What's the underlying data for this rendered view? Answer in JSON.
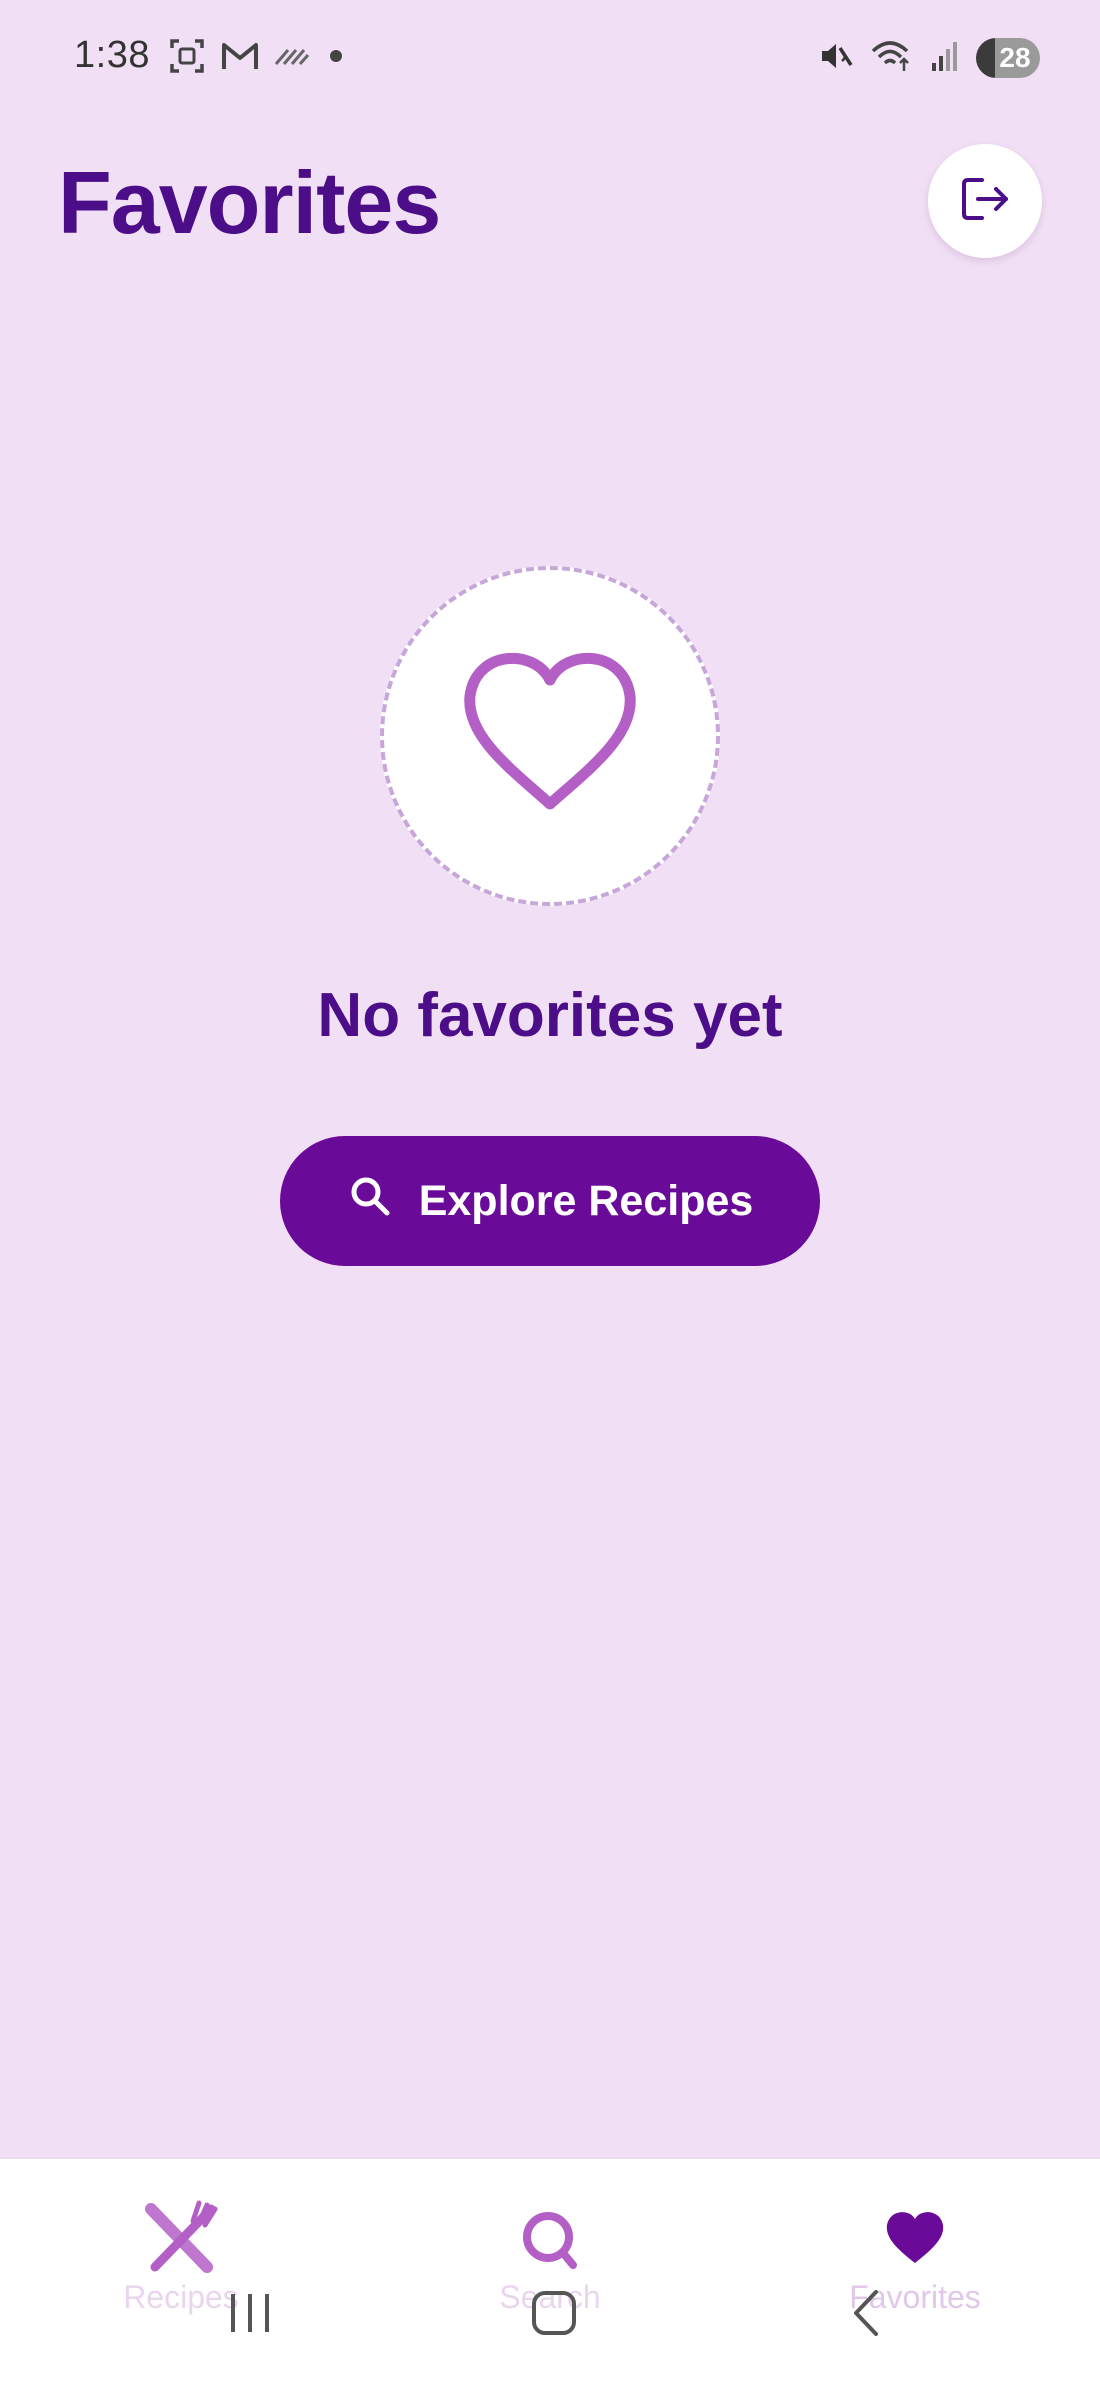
{
  "status_bar": {
    "time": "1:38",
    "battery_level": "28"
  },
  "header": {
    "title": "Favorites"
  },
  "empty_state": {
    "message": "No favorites yet",
    "button_label": "Explore Recipes"
  },
  "bottom_nav": {
    "items": [
      {
        "label": "Recipes",
        "icon": "fork-knife-icon",
        "active": false
      },
      {
        "label": "Search",
        "icon": "search-icon",
        "active": false
      },
      {
        "label": "Favorites",
        "icon": "heart-icon",
        "active": true
      }
    ]
  },
  "colors": {
    "background": "#f1e0f5",
    "primary": "#6a0a99",
    "title": "#4b0d88",
    "accent": "#b35fc6"
  }
}
